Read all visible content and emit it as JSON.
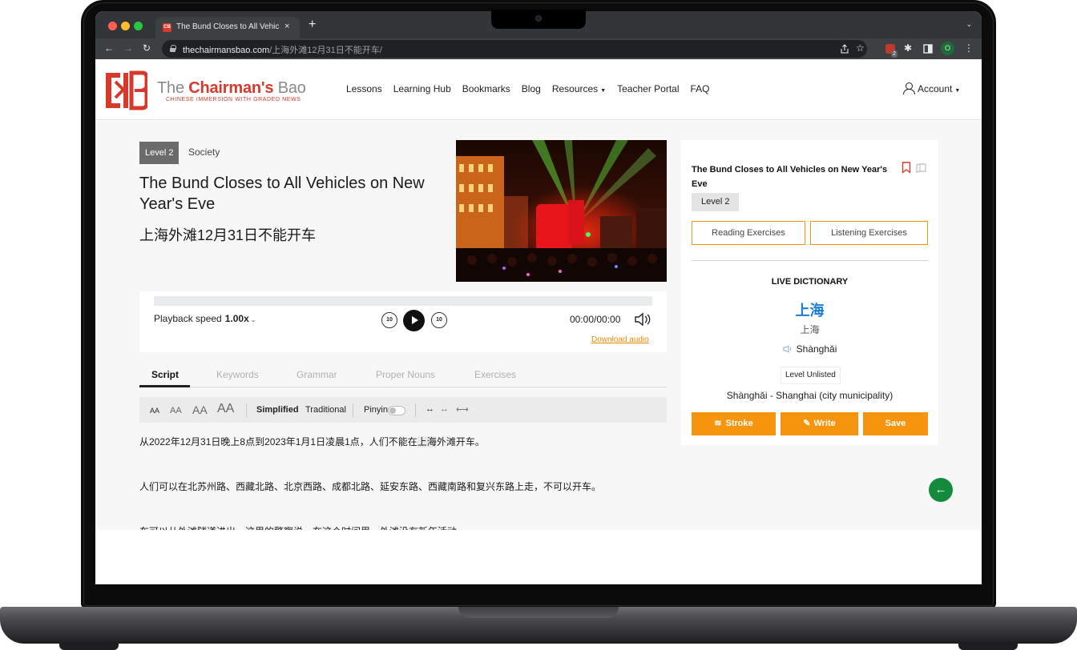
{
  "browser": {
    "tab_title": "The Bund Closes to All Vehicle",
    "tab_close": "×",
    "new_tab": "+",
    "url_host": "thechairmansbao.com",
    "url_path": "/上海外滩12月31日不能开车/",
    "extension_badge": "2",
    "profile_initial": "O"
  },
  "header": {
    "brand_the": "The ",
    "brand_name": "Chairman's",
    "brand_bao": " Bao",
    "brand_sub": "CHINESE IMMERSION WITH GRADED NEWS",
    "nav": [
      "Lessons",
      "Learning Hub",
      "Bookmarks",
      "Blog",
      "Resources",
      "Teacher Portal",
      "FAQ"
    ],
    "account": "Account"
  },
  "article": {
    "level": "Level 2",
    "category": "Society",
    "title": "The Bund Closes to All Vehicles on New Year's Eve",
    "title_cn": "上海外滩12月31日不能开车"
  },
  "player": {
    "speed_label": "Playback speed",
    "speed_value": "1.00x",
    "skip_back": "10",
    "skip_forward": "10",
    "time": "00:00/00:00",
    "download": "Download audio"
  },
  "tabs": [
    "Script",
    "Keywords",
    "Grammar",
    "Proper Nouns",
    "Exercises"
  ],
  "textbar": {
    "sizes": [
      "AA",
      "AA",
      "AA",
      "AA"
    ],
    "simplified": "Simplified",
    "traditional": "Traditional",
    "pinyin": "Pinyin",
    "widths": [
      "↔",
      "↔",
      "⟷"
    ]
  },
  "script": {
    "p1_before": "从2022年12月31日晚上8点到2023年1月1日凌晨1点，人们不能在",
    "p1_highlight": "上海",
    "p1_after": "外滩开车。",
    "p2": "人们可以在北苏州路、西藏北路、北京西路、成都北路、延安东路、西藏南路和复兴东路上走，不可以开车。",
    "p3": "车可以从外滩隧道进出。这里的警察说，在这个时间里，外滩没有新年活动。"
  },
  "panel": {
    "title": "The Bund Closes to All Vehicles on New Year's Eve",
    "level": "Level 2",
    "reading": "Reading Exercises",
    "listening": "Listening Exercises",
    "dictionary": {
      "heading": "LIVE DICTIONARY",
      "word": "上海",
      "traditional": "上海",
      "pinyin": "Shànghǎi",
      "level": "Level Unlisted",
      "definition": "Shànghǎi - Shanghai (city municipality)"
    },
    "actions": [
      "Stroke",
      "Write",
      "Save"
    ]
  },
  "back_icon": "←",
  "colors": {
    "brand_red": "#d7392c",
    "accent_orange": "#f7940d",
    "dictionary_blue": "#1a7dd6",
    "back_green": "#138a3c"
  }
}
